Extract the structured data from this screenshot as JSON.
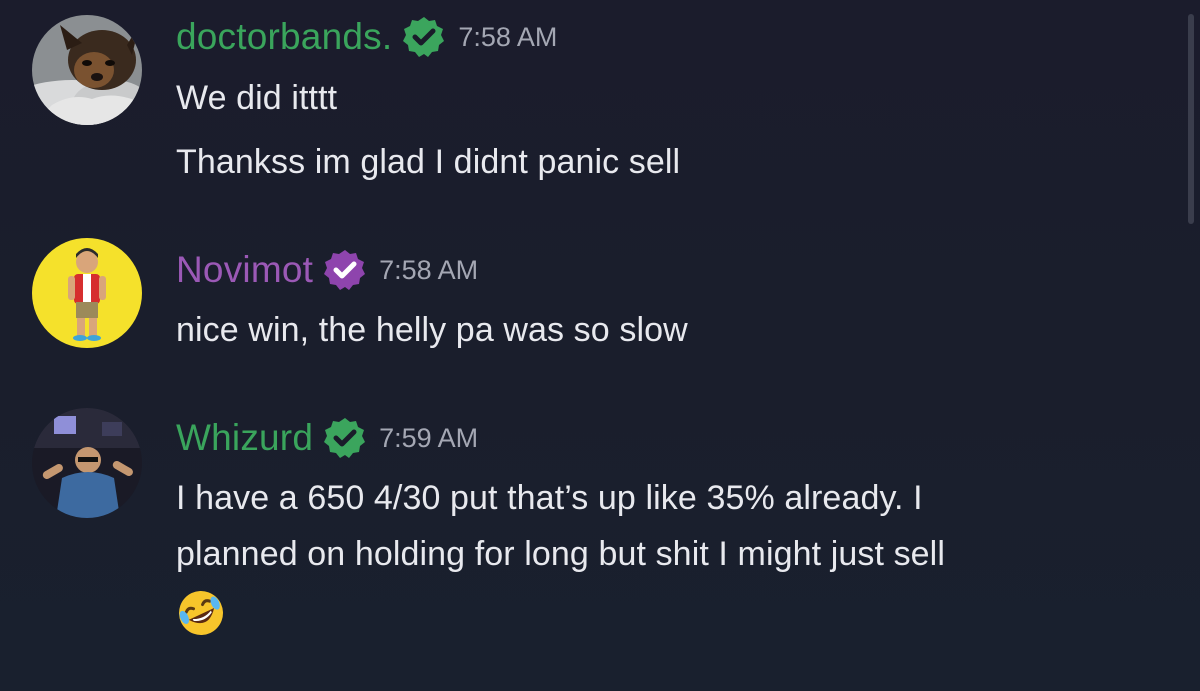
{
  "messages": [
    {
      "username": "doctorbands.",
      "username_color": "#3aa55c",
      "badge_color": "#3ba55d",
      "badge_icon": "verified-check-icon",
      "timestamp": "7:58 AM",
      "lines": [
        "We did itttt",
        "Thankss im glad I didnt panic sell"
      ]
    },
    {
      "username": "Novimot",
      "username_color": "#9b59b6",
      "badge_color": "#8e44ad",
      "badge_icon": "verified-check-icon",
      "timestamp": "7:58 AM",
      "lines": [
        "nice win, the helly pa was so slow"
      ]
    },
    {
      "username": "Whizurd",
      "username_color": "#3aa55c",
      "badge_color": "#3ba55d",
      "badge_icon": "verified-check-icon",
      "timestamp": "7:59 AM",
      "lines": [
        "I have a 650 4/30 put that’s up like 35% already. I",
        "planned on holding for long but shit I might just sell"
      ],
      "emoji": "rolling-on-floor-laughing-emoji"
    }
  ]
}
